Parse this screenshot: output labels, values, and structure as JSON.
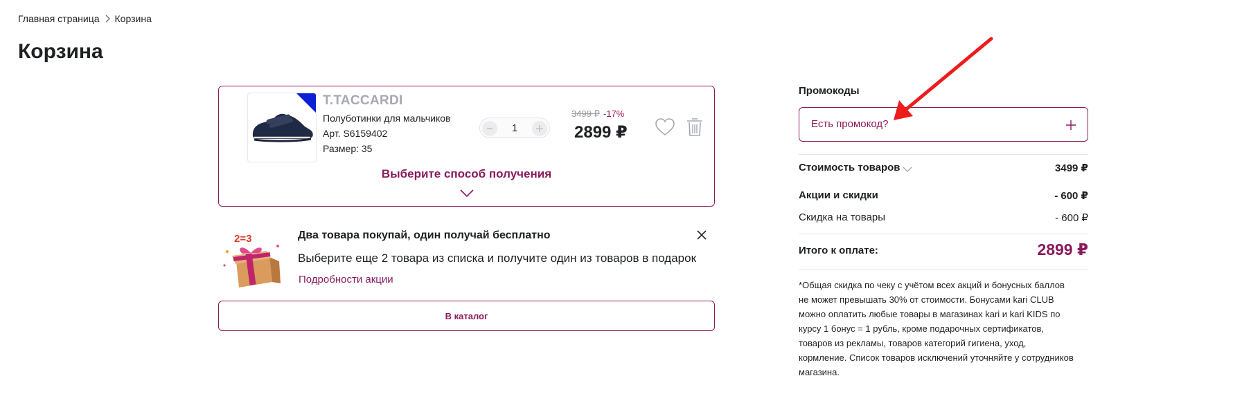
{
  "breadcrumb": {
    "home": "Главная страница",
    "current": "Корзина"
  },
  "page": {
    "title": "Корзина"
  },
  "cart_item": {
    "brand": "T.TACCARDI",
    "name": "Полуботинки для мальчиков",
    "article": "Арт. S6159402",
    "size": "Размер: 35",
    "quantity": "1",
    "old_price": "3499 ₽",
    "discount": "-17%",
    "price": "2899 ₽",
    "delivery_link": "Выберите способ получения",
    "corner_badge_color": "#0a1fd6"
  },
  "promo_banner": {
    "badge": "2=3",
    "title": "Два товара покупай, один получай бесплатно",
    "description": "Выберите еще 2 товара из списка и получите один из товаров в подарок",
    "link": "Подробности акции"
  },
  "catalog_button": "В каталог",
  "summary": {
    "promo_heading": "Промокоды",
    "promo_placeholder": "Есть промокод?",
    "goods_label": "Стоимость товаров",
    "goods_value": "3499 ₽",
    "promotions_label": "Акции и скидки",
    "promotions_value": "- 600 ₽",
    "discount_label": "Скидка на товары",
    "discount_value": "- 600 ₽",
    "total_label": "Итого к оплате:",
    "total_value": "2899 ₽",
    "footnote": "*Общая скидка по чеку с учётом всех акций и бонусных баллов не может превышать 30% от стоимости. Бонусами kari CLUB можно оплатить любые товары в магазинах kari и kari KIDS по курсу 1 бонус = 1 рубль, кроме подарочных сертификатов, товаров из рекламы, товаров категорий гигиена, уход, кормление. Список товаров исключений уточняйте у сотрудников магазина."
  },
  "colors": {
    "accent": "#8a1a5c",
    "text": "#1e2023",
    "muted": "#9b9ba3",
    "annotation_arrow": "#ee1c1c"
  },
  "icons": [
    "chevron-right-icon",
    "minus-icon",
    "plus-icon",
    "heart-icon",
    "trash-icon",
    "chevron-down-icon",
    "gift-icon",
    "close-icon",
    "annotation-arrow"
  ]
}
